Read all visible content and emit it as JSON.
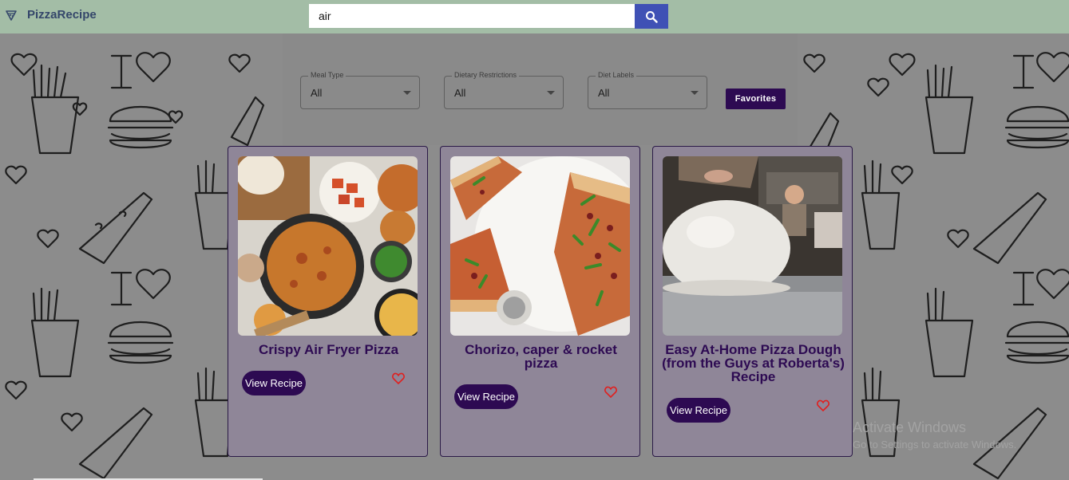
{
  "header": {
    "brand": "PizzaRecipe",
    "search_value": "air",
    "search_icon": "search-icon",
    "logo_icon": "pizza-slice-icon"
  },
  "filters": [
    {
      "label": "Meal Type",
      "value": "All"
    },
    {
      "label": "Dietary Restrictions",
      "value": "All"
    },
    {
      "label": "Diet Labels",
      "value": "All"
    }
  ],
  "favorites_label": "Favorites",
  "cards": [
    {
      "title": "Crispy Air Fryer Pizza",
      "button": "View Recipe"
    },
    {
      "title": "Chorizo, caper & rocket pizza",
      "button": "View Recipe"
    },
    {
      "title": "Easy At-Home Pizza Dough (from the Guys at Roberta's) Recipe",
      "button": "View Recipe"
    }
  ],
  "watermark": {
    "line1": "Activate Windows",
    "line2": "Go to Settings to activate Windows."
  },
  "colors": {
    "appbar": "#a3bda6",
    "brand": "#34466a",
    "accent": "#2d0a52",
    "search_button": "#3f51b5",
    "heart": "#e0201f"
  }
}
